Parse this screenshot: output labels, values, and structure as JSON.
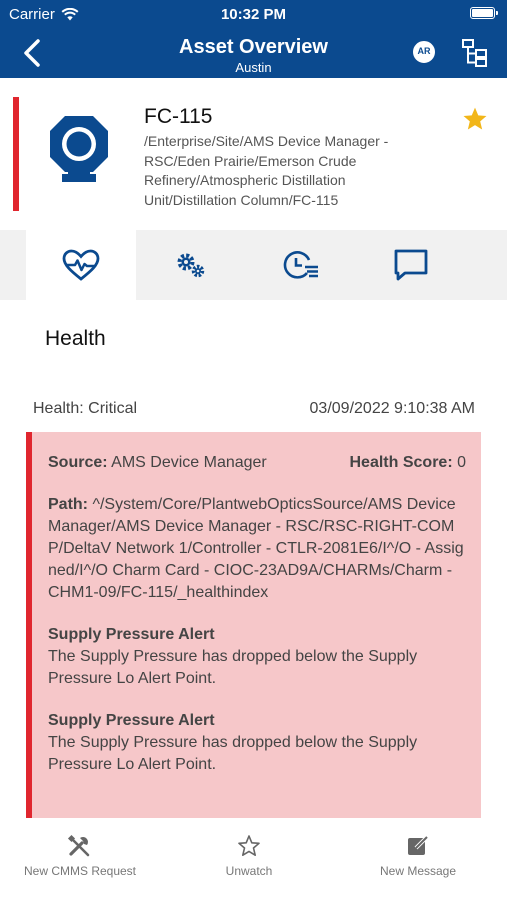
{
  "status_bar": {
    "carrier": "Carrier",
    "time": "10:32 PM"
  },
  "nav": {
    "title": "Asset Overview",
    "subtitle": "Austin",
    "ar_label": "AR"
  },
  "asset": {
    "name": "FC-115",
    "path": "/Enterprise/Site/AMS Device Manager - RSC/Eden Prairie/Emerson Crude Refinery/Atmospheric Distillation Unit/Distillation Column/FC-115",
    "favorite": true
  },
  "tabs": [
    {
      "icon": "heart-pulse-icon",
      "active": true
    },
    {
      "icon": "gears-icon",
      "active": false
    },
    {
      "icon": "clock-list-icon",
      "active": false
    },
    {
      "icon": "message-icon",
      "active": false
    }
  ],
  "health": {
    "title": "Health",
    "status": "Health: Critical",
    "timestamp": "03/09/2022 9:10:38 AM",
    "source_label": "Source:",
    "source_value": "AMS Device Manager",
    "score_label": "Health Score:",
    "score_value": "0",
    "path_label": "Path:",
    "path_value": "^/System/Core/PlantwebOpticsSource/AMS Device Manager/AMS Device Manager - RSC/RSC-RIGHT-COMP/DeltaV Network 1/Controller - CTLR-2081E6/I^/O - Assigned/I^/O Charm Card - CIOC-23AD9A/CHARMs/Charm - CHM1-09/FC-115/_healthindex",
    "alerts": [
      {
        "title": "Supply Pressure Alert",
        "text": "The Supply Pressure has dropped below the Supply Pressure Lo Alert Point."
      },
      {
        "title": "Supply Pressure Alert",
        "text": "The Supply Pressure has dropped below the Supply Pressure Lo Alert Point."
      }
    ]
  },
  "bottom_bar": {
    "cmms_label": "New CMMS Request",
    "watch_label": "Unwatch",
    "message_label": "New Message"
  },
  "colors": {
    "header": "#0b4a8f",
    "critical": "#e0262e",
    "card": "#f6c7c9",
    "star": "#f2b619"
  }
}
